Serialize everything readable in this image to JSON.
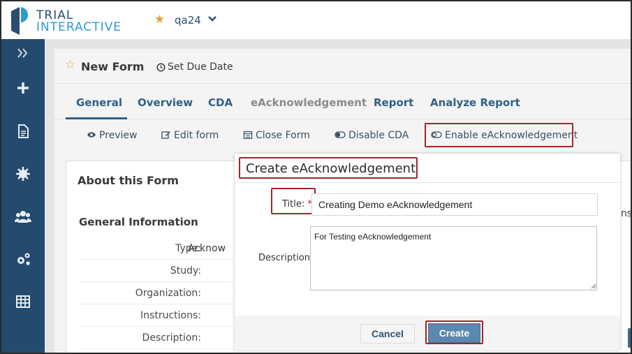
{
  "header": {
    "logo_line1": "TRIAL",
    "logo_line2": "INTERACTIVE",
    "study_name": "qa24"
  },
  "sidebar": {
    "items": [
      {
        "icon": "expand-icon"
      },
      {
        "icon": "plus-icon"
      },
      {
        "icon": "document-icon"
      },
      {
        "icon": "gear-icon"
      },
      {
        "icon": "users-icon"
      },
      {
        "icon": "cogs-icon"
      },
      {
        "icon": "table-icon"
      }
    ]
  },
  "form": {
    "title": "New Form",
    "due_date_label": "Set Due Date"
  },
  "tabs": [
    {
      "label": "General"
    },
    {
      "label": "Overview"
    },
    {
      "label": "CDA"
    },
    {
      "label": "eAcknowledgement"
    },
    {
      "label": "Report"
    },
    {
      "label": "Analyze Report"
    }
  ],
  "actions": {
    "preview": "Preview",
    "edit_form": "Edit form",
    "close_form": "Close Form",
    "disable_cda": "Disable CDA",
    "enable_eack": "Enable eAcknowledgement"
  },
  "about": {
    "title": "About this Form",
    "general_info_title": "General Information",
    "fields": [
      {
        "label": "Type:",
        "value": "Acknow"
      },
      {
        "label": "Study:",
        "value": ""
      },
      {
        "label": "Organization:",
        "value": ""
      },
      {
        "label": "Instructions:",
        "value": ""
      },
      {
        "label": "Description:",
        "value": ""
      }
    ],
    "right_cut_text": "nse"
  },
  "modal": {
    "title": "Create eAcknowledgement",
    "title_label": "Title:",
    "required_mark": "*",
    "title_value": "Creating Demo eAcknowledgement",
    "description_label": "Description:",
    "description_value": "For Testing eAcknowledgement",
    "cancel_label": "Cancel",
    "create_label": "Create"
  },
  "colors": {
    "sidebar_bg": "#244a6e",
    "accent": "#2f6088",
    "highlight_border": "#a3242a",
    "create_button": "#5b88ae",
    "star": "#e2a23a"
  }
}
